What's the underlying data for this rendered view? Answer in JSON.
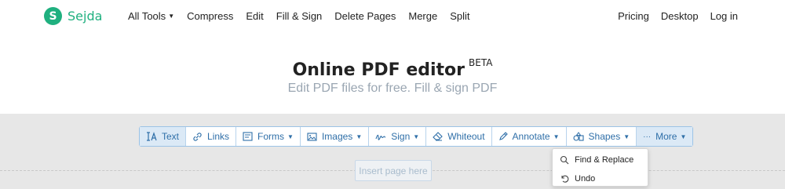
{
  "brand": {
    "logo_letter": "S",
    "name": "Sejda",
    "color": "#1fb07f"
  },
  "nav": {
    "left": [
      {
        "label": "All Tools",
        "has_caret": true
      },
      {
        "label": "Compress"
      },
      {
        "label": "Edit"
      },
      {
        "label": "Fill & Sign"
      },
      {
        "label": "Delete Pages"
      },
      {
        "label": "Merge"
      },
      {
        "label": "Split"
      }
    ],
    "right": [
      "Pricing",
      "Desktop",
      "Log in"
    ]
  },
  "hero": {
    "title": "Online PDF editor",
    "badge": "BETA",
    "subtitle": "Edit PDF files for free. Fill & sign PDF"
  },
  "toolbar": {
    "accent": "#2f6fa8",
    "items": [
      {
        "label": "Text",
        "icon": "text-cursor-icon",
        "active": true
      },
      {
        "label": "Links",
        "icon": "link-icon"
      },
      {
        "label": "Forms",
        "icon": "form-icon",
        "dropdown": true
      },
      {
        "label": "Images",
        "icon": "image-icon",
        "dropdown": true
      },
      {
        "label": "Sign",
        "icon": "signature-icon",
        "dropdown": true
      },
      {
        "label": "Whiteout",
        "icon": "eraser-icon"
      },
      {
        "label": "Annotate",
        "icon": "pencil-icon",
        "dropdown": true
      },
      {
        "label": "Shapes",
        "icon": "shapes-icon",
        "dropdown": true
      },
      {
        "label": "More",
        "icon": "ellipsis-icon",
        "dropdown": true,
        "open": true
      }
    ]
  },
  "more_menu": {
    "items": [
      {
        "label": "Find & Replace",
        "icon": "search-icon"
      },
      {
        "label": "Undo",
        "icon": "undo-icon"
      }
    ]
  },
  "insert_page": {
    "label": "Insert page here"
  }
}
